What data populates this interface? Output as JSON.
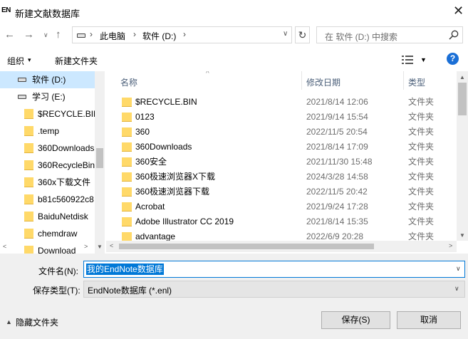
{
  "window": {
    "app_badge": "EN",
    "title": "新建文献数据库",
    "close_glyph": "✕"
  },
  "address_bar": {
    "breadcrumbs": [
      "此电脑",
      "软件 (D:)"
    ],
    "separator": "›",
    "search_placeholder": "在 软件 (D:) 中搜索"
  },
  "toolbar": {
    "organize_label": "组织",
    "new_folder_label": "新建文件夹",
    "help_label": "?"
  },
  "nav_pane": {
    "items": [
      {
        "label": "软件 (D:)",
        "kind": "drive",
        "selected": true
      },
      {
        "label": "学习 (E:)",
        "kind": "drive",
        "selected": false
      },
      {
        "label": "$RECYCLE.BIN",
        "kind": "folder",
        "selected": false
      },
      {
        "label": ".temp",
        "kind": "folder",
        "selected": false
      },
      {
        "label": "360Downloads",
        "kind": "folder",
        "selected": false
      },
      {
        "label": "360RecycleBin",
        "kind": "folder",
        "selected": false
      },
      {
        "label": "360x下载文件",
        "kind": "folder",
        "selected": false
      },
      {
        "label": "b81c560922c8",
        "kind": "folder",
        "selected": false
      },
      {
        "label": "BaiduNetdisk",
        "kind": "folder",
        "selected": false
      },
      {
        "label": "chemdraw",
        "kind": "folder",
        "selected": false
      },
      {
        "label": "Download",
        "kind": "folder",
        "selected": false
      }
    ]
  },
  "file_list": {
    "columns": {
      "name": "名称",
      "date": "修改日期",
      "type": "类型"
    },
    "rows": [
      {
        "name": "$RECYCLE.BIN",
        "date": "2021/8/14 12:06",
        "type": "文件夹"
      },
      {
        "name": "0123",
        "date": "2021/9/14 15:54",
        "type": "文件夹"
      },
      {
        "name": "360",
        "date": "2022/11/5 20:54",
        "type": "文件夹"
      },
      {
        "name": "360Downloads",
        "date": "2021/8/14 17:09",
        "type": "文件夹"
      },
      {
        "name": "360安全",
        "date": "2021/11/30 15:48",
        "type": "文件夹"
      },
      {
        "name": "360极速浏览器X下载",
        "date": "2024/3/28 14:58",
        "type": "文件夹"
      },
      {
        "name": "360极速浏览器下载",
        "date": "2022/11/5 20:42",
        "type": "文件夹"
      },
      {
        "name": "Acrobat",
        "date": "2021/9/24 17:28",
        "type": "文件夹"
      },
      {
        "name": "Adobe Illustrator CC 2019",
        "date": "2021/8/14 15:35",
        "type": "文件夹"
      },
      {
        "name": "advantage",
        "date": "2022/6/9 20:28",
        "type": "文件夹"
      }
    ]
  },
  "form": {
    "filename_label": "文件名(N):",
    "filename_value": "我的EndNote数据库",
    "savetype_label": "保存类型(T):",
    "savetype_value": "EndNote数据库 (*.enl)",
    "hide_folders_label": "隐藏文件夹",
    "save_label": "保存(S)",
    "cancel_label": "取消"
  }
}
